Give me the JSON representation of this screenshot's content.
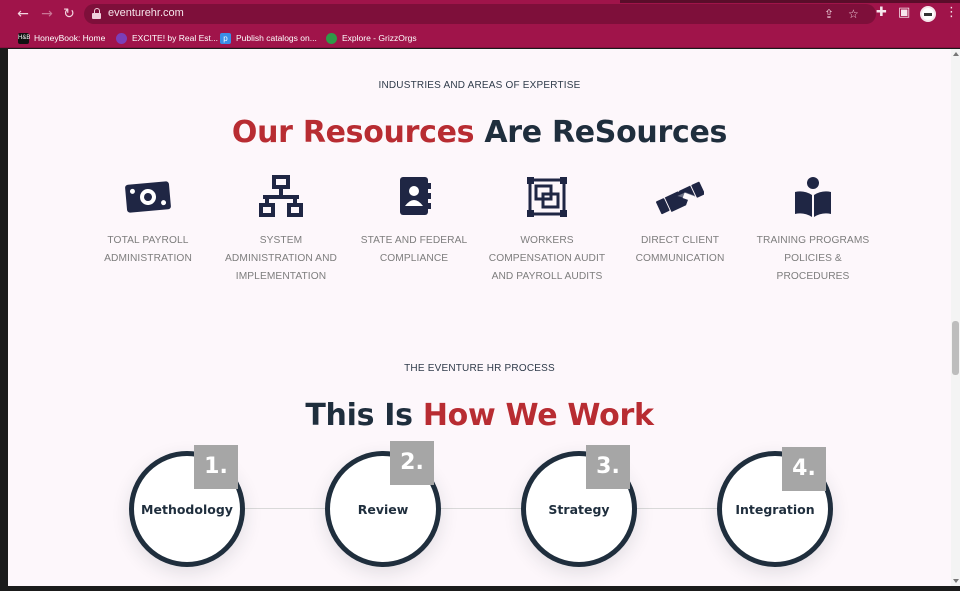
{
  "browser": {
    "url": "eventurehr.com",
    "bookmarks": [
      {
        "label": "HoneyBook: Home",
        "icon": "honeybook-icon",
        "icon_text": "H&B",
        "color": "#111111"
      },
      {
        "label": "EXCITE! by Real Est...",
        "icon": "excite-icon",
        "icon_text": "",
        "color": "#7b3fb8"
      },
      {
        "label": "Publish catalogs on...",
        "icon": "publish-icon",
        "icon_text": "p",
        "color": "#3a8ee6"
      },
      {
        "label": "Explore - GrizzOrgs",
        "icon": "grizzorgs-icon",
        "icon_text": "",
        "color": "#2f9a48"
      }
    ]
  },
  "resources": {
    "eyebrow": "INDUSTRIES AND AREAS OF EXPERTISE",
    "title_red": "Our Resources",
    "title_navy": "Are ReSources",
    "items": [
      {
        "icon": "money-bill-icon",
        "label": "TOTAL PAYROLL ADMINISTRATION"
      },
      {
        "icon": "network-icon",
        "label": "SYSTEM ADMINISTRATION AND IMPLEMENTATION"
      },
      {
        "icon": "address-book-icon",
        "label": "STATE AND FEDERAL COMPLIANCE"
      },
      {
        "icon": "object-group-icon",
        "label": "WORKERS COMPENSATION AUDIT AND PAYROLL AUDITS"
      },
      {
        "icon": "handshake-icon",
        "label": "DIRECT CLIENT COMMUNICATION"
      },
      {
        "icon": "book-reader-icon",
        "label": "TRAINING PROGRAMS POLICIES & PROCEDURES"
      }
    ]
  },
  "process": {
    "eyebrow": "THE EVENTURE HR PROCESS",
    "title_navy": "This Is",
    "title_red": "How We Work",
    "steps": [
      {
        "number": "1.",
        "name": "Methodology"
      },
      {
        "number": "2.",
        "name": "Review"
      },
      {
        "number": "3.",
        "name": "Strategy"
      },
      {
        "number": "4.",
        "name": "Integration"
      }
    ]
  },
  "colors": {
    "brand_red": "#b82c32",
    "navy": "#1f2e3d",
    "chrome": "#a0144a"
  }
}
